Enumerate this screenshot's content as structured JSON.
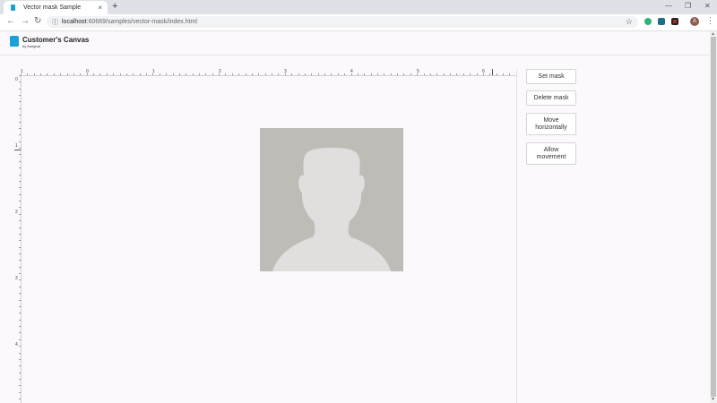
{
  "browser": {
    "tab_title": "Vector mask Sample",
    "tab_close": "×",
    "new_tab": "+",
    "url_host": "localhost",
    "url_rest": ":60669/samples/vector-mask/index.html",
    "back_icon": "arrow-left-icon",
    "forward_icon": "arrow-right-icon",
    "reload_icon": "reload-icon",
    "info_icon": "info-icon",
    "star_icon": "star-icon",
    "avatar_letter": "A",
    "extension_colors": [
      "#2bb673",
      "#1f6f8b",
      "#b3261e"
    ]
  },
  "app": {
    "brand": "Customer's Canvas",
    "brand_sub": "by Aurigma"
  },
  "ruler": {
    "h_labels": [
      "1",
      "0",
      "1",
      "2",
      "3",
      "4",
      "5",
      "6"
    ],
    "v_labels": [
      "0",
      "1",
      "2",
      "3",
      "4"
    ]
  },
  "buttons": {
    "set_mask": "Set mask",
    "delete_mask": "Delete mask",
    "move_horizontally": "Move horizontally",
    "allow_movement": "Allow movement"
  }
}
